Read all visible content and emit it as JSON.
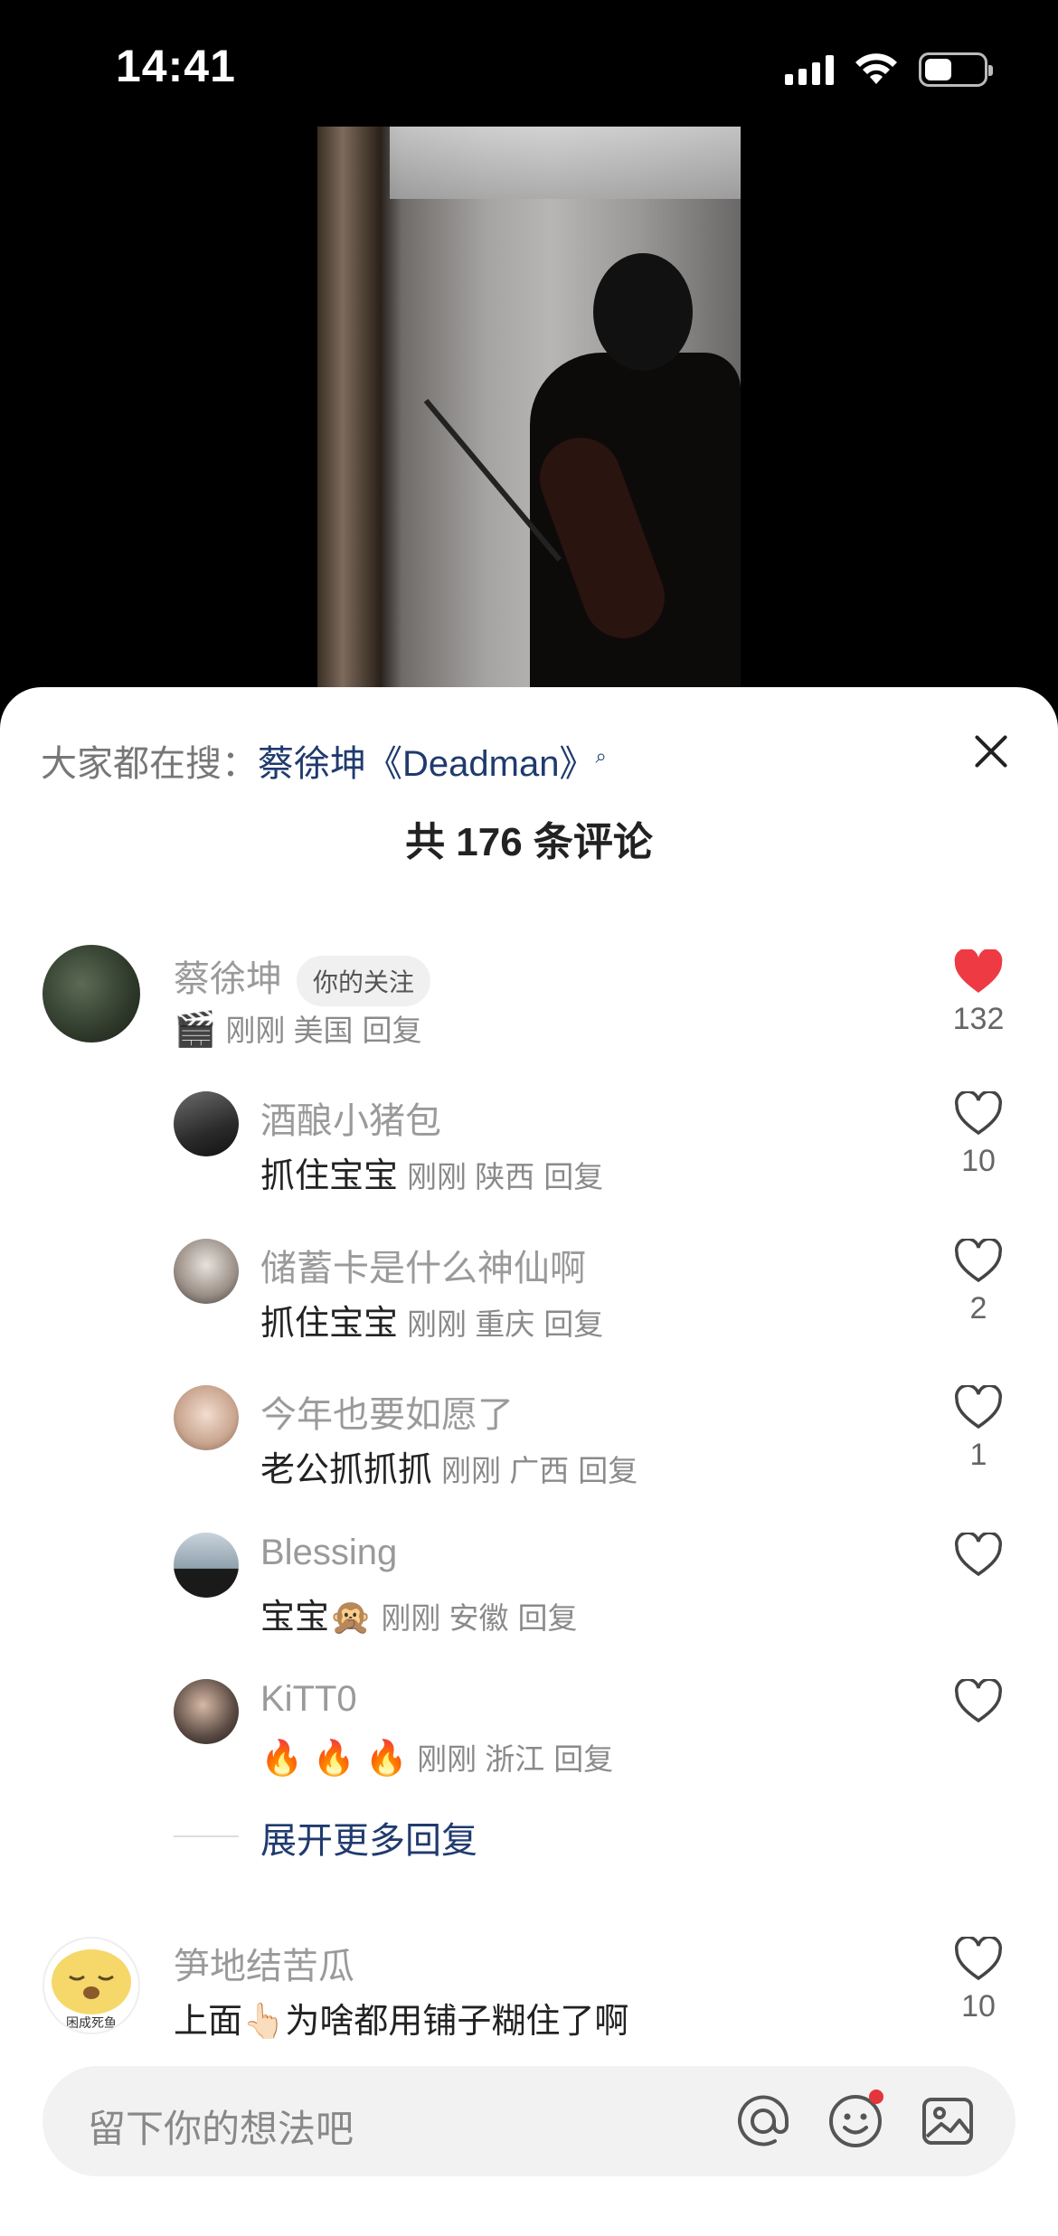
{
  "status_bar": {
    "time": "14:41",
    "battery_level": 0.45
  },
  "sheet": {
    "search_hint": {
      "prefix": "大家都在搜：",
      "term": "蔡徐坤《Deadman》"
    },
    "comment_count_text": "共 176 条评论",
    "comments": [
      {
        "name": "蔡徐坤",
        "badge": "你的关注",
        "text": "🎬",
        "time": "刚刚",
        "location": "美国",
        "reply": "回复",
        "likes": "132",
        "liked": true
      }
    ],
    "replies": [
      {
        "name": "酒酿小猪包",
        "text": "抓住宝宝",
        "time": "刚刚",
        "location": "陕西",
        "reply": "回复",
        "likes": "10"
      },
      {
        "name": "储蓄卡是什么神仙啊",
        "text": "抓住宝宝",
        "time": "刚刚",
        "location": "重庆",
        "reply": "回复",
        "likes": "2"
      },
      {
        "name": "今年也要如愿了",
        "text": "老公抓抓抓",
        "time": "刚刚",
        "location": "广西",
        "reply": "回复",
        "likes": "1"
      },
      {
        "name": "Blessing",
        "text": "宝宝🙊",
        "time": "刚刚",
        "location": "安徽",
        "reply": "回复",
        "likes": ""
      },
      {
        "name": "KiTT0",
        "text": "🔥 🔥 🔥",
        "time": "刚刚",
        "location": "浙江",
        "reply": "回复",
        "likes": ""
      }
    ],
    "more_replies": "展开更多回复",
    "second_comment": {
      "name": "笋地结苦瓜",
      "text": "上面👆🏻为啥都用铺子糊住了啊",
      "likes": "10",
      "avatar_caption": "困成死鱼"
    },
    "input": {
      "placeholder": "留下你的想法吧"
    },
    "colors": {
      "like_red": "#ee3a43",
      "link_blue": "#1f3a6e"
    }
  }
}
